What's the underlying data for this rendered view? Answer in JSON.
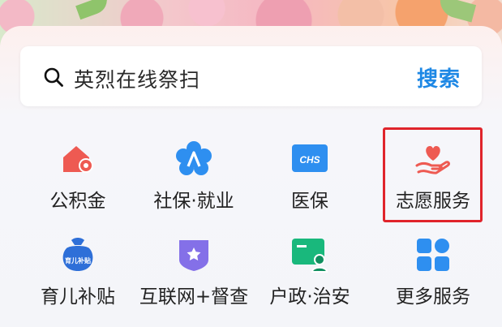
{
  "search": {
    "placeholder": "英烈在线祭扫",
    "button_label": "搜索"
  },
  "services": [
    {
      "label": "公积金",
      "icon": "house-coin-icon"
    },
    {
      "label": "社保·就业",
      "icon": "social-security-icon"
    },
    {
      "label": "医保",
      "icon": "chs-card-icon"
    },
    {
      "label": "志愿服务",
      "icon": "hand-heart-icon"
    },
    {
      "label": "育儿补贴",
      "icon": "childcare-bag-icon"
    },
    {
      "label": "互联网+督查",
      "icon": "shield-star-icon"
    },
    {
      "label": "户政·治安",
      "icon": "id-card-icon"
    },
    {
      "label": "更多服务",
      "icon": "grid-icon"
    }
  ],
  "icon_texts": {
    "chs": "CHS",
    "childcare": "育儿补贴"
  },
  "colors": {
    "accent": "#1e88e5",
    "highlight": "#e0242b",
    "red_icon": "#ee5a52",
    "blue_icon": "#2e8ff0",
    "purple_icon": "#8470e8",
    "green_icon": "#19b87c"
  }
}
